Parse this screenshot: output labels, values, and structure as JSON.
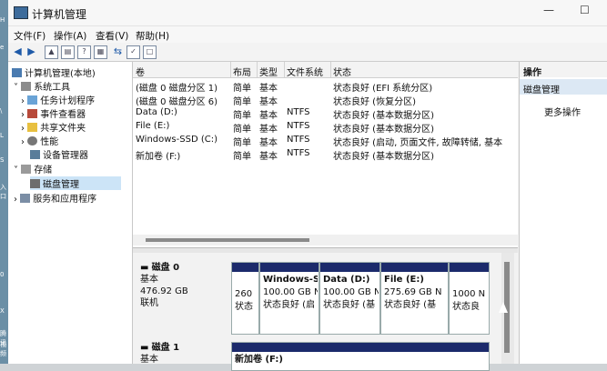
{
  "window": {
    "title": "计算机管理"
  },
  "menu": [
    "文件(F)",
    "操作(A)",
    "查看(V)",
    "帮助(H)"
  ],
  "tree": {
    "root": "计算机管理(本地)",
    "system_tools": "系统工具",
    "task_scheduler": "任务计划程序",
    "event_viewer": "事件查看器",
    "shared_folders": "共享文件夹",
    "performance": "性能",
    "device_manager": "设备管理器",
    "storage": "存储",
    "disk_management": "磁盘管理",
    "services_apps": "服务和应用程序"
  },
  "volumes": {
    "headers": [
      "卷",
      "布局",
      "类型",
      "文件系统",
      "状态"
    ],
    "rows": [
      {
        "name": "(磁盘 0 磁盘分区 1)",
        "layout": "简单",
        "type": "基本",
        "fs": "",
        "status": "状态良好 (EFI 系统分区)"
      },
      {
        "name": "(磁盘 0 磁盘分区 6)",
        "layout": "简单",
        "type": "基本",
        "fs": "",
        "status": "状态良好 (恢复分区)"
      },
      {
        "name": "Data (D:)",
        "layout": "简单",
        "type": "基本",
        "fs": "NTFS",
        "status": "状态良好 (基本数据分区)"
      },
      {
        "name": "File (E:)",
        "layout": "简单",
        "type": "基本",
        "fs": "NTFS",
        "status": "状态良好 (基本数据分区)"
      },
      {
        "name": "Windows-SSD (C:)",
        "layout": "简单",
        "type": "基本",
        "fs": "NTFS",
        "status": "状态良好 (启动, 页面文件, 故障转储, 基本"
      },
      {
        "name": "新加卷 (F:)",
        "layout": "简单",
        "type": "基本",
        "fs": "NTFS",
        "status": "状态良好 (基本数据分区)"
      }
    ]
  },
  "disks": {
    "disk0": {
      "label": "磁盘 0",
      "type": "基本",
      "size": "476.92 GB",
      "state": "联机"
    },
    "disk1": {
      "label": "磁盘 1",
      "type": "基本",
      "size": "",
      "state": ""
    },
    "partitions": [
      {
        "name": "",
        "size": "260",
        "status": "状态"
      },
      {
        "name": "Windows-S",
        "size": "100.00 GB N",
        "status": "状态良好 (启"
      },
      {
        "name": "Data  (D:)",
        "size": "100.00 GB N",
        "status": "状态良好 (基"
      },
      {
        "name": "File  (E:)",
        "size": "275.69 GB N",
        "status": "状态良好 (基"
      },
      {
        "name": "",
        "size": "1000 N",
        "status": "状态良"
      }
    ],
    "disk1_partition": "新加卷 (F:)"
  },
  "actions": {
    "header": "操作",
    "selected": "磁盘管理",
    "more": "更多操作"
  },
  "desktop_fragments": [
    "H",
    "",
    "e",
    "\\",
    "L",
    "S",
    "",
    "入口",
    "",
    "0",
    "",
    "",
    "X",
    "腾讯",
    "视频"
  ]
}
